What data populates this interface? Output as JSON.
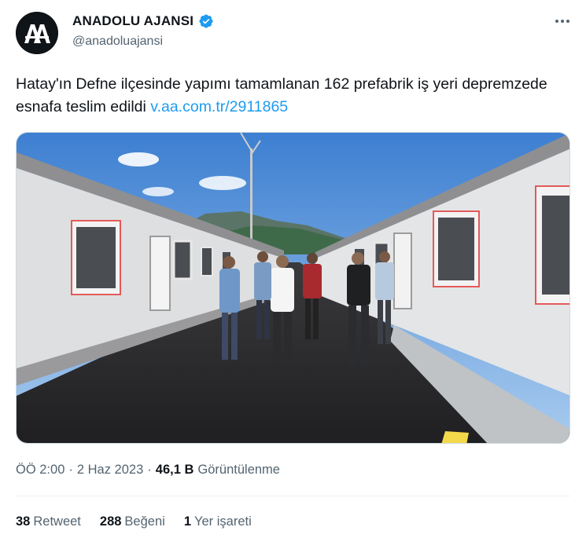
{
  "author": {
    "display_name": "ANADOLU AJANSI",
    "handle": "@anadoluajansi",
    "avatar_text": "AA",
    "verified_color": "#1d9bf0"
  },
  "tweet": {
    "text": "Hatay'ın Defne ilçesinde yapımı tamamlanan 162 prefabrik iş yeri depremzede esnafa teslim edildi",
    "link": "v.aa.com.tr/2911865"
  },
  "meta": {
    "time": "ÖÖ 2:00",
    "separator": "·",
    "date": "2 Haz 2023",
    "views_count": "46,1 B",
    "views_label": "Görüntülenme"
  },
  "stats": {
    "retweets_count": "38",
    "retweets_label": "Retweet",
    "likes_count": "288",
    "likes_label": "Beğeni",
    "bookmarks_count": "1",
    "bookmarks_label": "Yer işareti"
  }
}
